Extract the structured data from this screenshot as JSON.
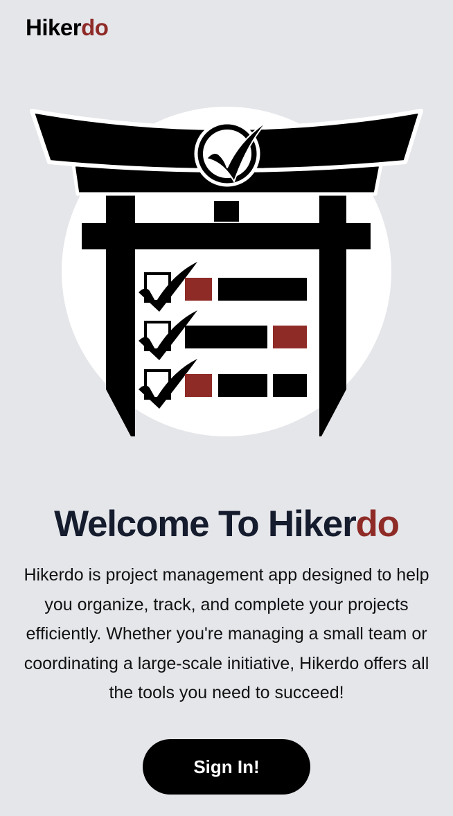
{
  "header": {
    "brand_main": "Hiker",
    "brand_accent": "do"
  },
  "hero": {
    "icon": "torii-checklist-logo"
  },
  "welcome": {
    "title_main": "Welcome To Hiker",
    "title_accent": "do",
    "description": "Hikerdo is project management app designed to help you organize, track, and complete your projects efficiently. Whether you're managing a small team or coordinating a large-scale initiative, Hikerdo offers all the tools you need to succeed!"
  },
  "actions": {
    "sign_in_label": "Sign In!"
  },
  "colors": {
    "background": "#e5e6ea",
    "accent": "#8f2b27",
    "text": "#151c2d",
    "button": "#000000"
  }
}
